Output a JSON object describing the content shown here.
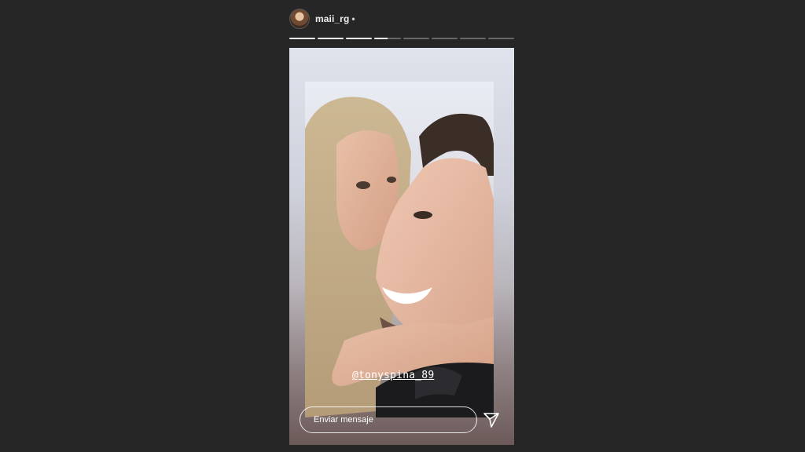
{
  "header": {
    "username": "maii_rg",
    "separator": "•"
  },
  "progress": {
    "segments": [
      1,
      1,
      1,
      0.5,
      0,
      0,
      0,
      0
    ]
  },
  "story": {
    "mention": "@tonyspina_89"
  },
  "reply": {
    "placeholder": "Enviar mensaje"
  },
  "icons": {
    "send": "paper-plane-icon",
    "avatar": "profile-avatar"
  }
}
